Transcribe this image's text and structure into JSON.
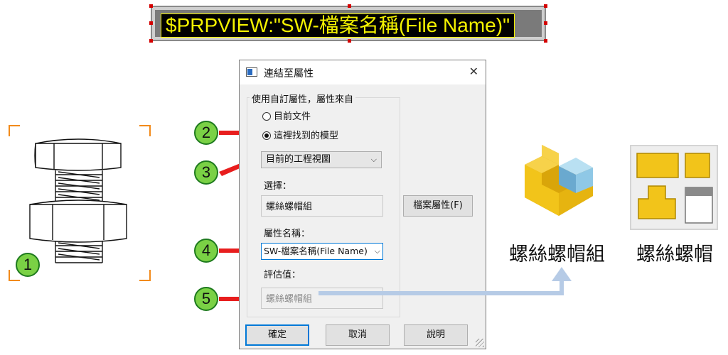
{
  "banner": {
    "text": "$PRPVIEW:\"SW-檔案名稱(File Name)\""
  },
  "callouts": [
    "1",
    "2",
    "3",
    "4",
    "5"
  ],
  "dialog": {
    "title": "連結至屬性",
    "group_label": "使用自訂屬性，屬性來自",
    "radio_current_doc": "目前文件",
    "radio_found_model": "這裡找到的模型",
    "view_dropdown": "目前的工程視圖",
    "selection_label": "選擇：",
    "selection_value": "螺絲螺帽組",
    "file_props_button": "檔案屬性(F)",
    "property_name_label": "屬性名稱：",
    "property_name_value": "SW-檔案名稱(File Name)",
    "evaluated_label": "評估值：",
    "evaluated_value": "螺絲螺帽組",
    "ok_button": "確定",
    "cancel_button": "取消",
    "help_button": "說明"
  },
  "right": {
    "assembly_name": "螺絲螺帽組",
    "part_name": "螺絲螺帽"
  },
  "colors": {
    "arrow_red": "#e81e1e",
    "callout_green": "#7ad145",
    "part_yellow": "#f2c41a",
    "part_blue": "#7fbfe0",
    "flow_arrow": "#b6cbe6",
    "bracket_orange": "#f28a1a"
  },
  "icons": [
    "close-icon",
    "dialog-app-icon",
    "chevron-down-icon",
    "assembly-3d-icon",
    "drawing-sheet-icon"
  ]
}
